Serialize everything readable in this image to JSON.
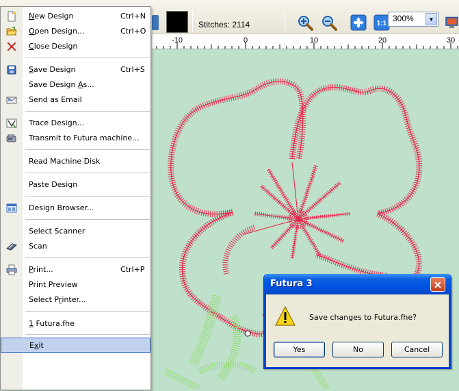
{
  "toolbar": {
    "stitches": "Stitches: 2114",
    "zoom_value": "300%",
    "icons": [
      "zoom-in-icon",
      "zoom-out-icon",
      "fit-to-window-icon",
      "actual-size-icon",
      "monitor-icon"
    ],
    "actual_size_label": "1:1"
  },
  "ruler": {
    "labels": [
      "-10",
      "0",
      "10",
      "20",
      "30"
    ]
  },
  "file_menu": {
    "items": [
      {
        "label": "New Design",
        "shortcut": "Ctrl+N",
        "icon": "new-design-icon"
      },
      {
        "label": "Open Design...",
        "shortcut": "Ctrl+O",
        "icon": "open-folder-icon"
      },
      {
        "label": "Close Design",
        "shortcut": "",
        "icon": "close-x-icon"
      },
      {
        "label": "Save Design",
        "shortcut": "Ctrl+S",
        "icon": "save-disk-icon"
      },
      {
        "label": "Save Design As...",
        "shortcut": "",
        "icon": ""
      },
      {
        "label": "Send as Email",
        "shortcut": "",
        "icon": "email-icon"
      },
      {
        "label": "Trace Design...",
        "shortcut": "",
        "icon": "trace-icon"
      },
      {
        "label": "Transmit to Futura machine...",
        "shortcut": "",
        "icon": "transmit-icon"
      },
      {
        "label": "Read Machine Disk",
        "shortcut": "",
        "icon": ""
      },
      {
        "label": "Paste Design",
        "shortcut": "",
        "icon": ""
      },
      {
        "label": "Design Browser...",
        "shortcut": "",
        "icon": "design-browser-icon"
      },
      {
        "label": "Select Scanner",
        "shortcut": "",
        "icon": ""
      },
      {
        "label": "Scan",
        "shortcut": "",
        "icon": "scan-icon"
      },
      {
        "label": "Print...",
        "shortcut": "Ctrl+P",
        "icon": "printer-icon"
      },
      {
        "label": "Print Preview",
        "shortcut": "",
        "icon": ""
      },
      {
        "label": "Select Printer...",
        "shortcut": "",
        "icon": ""
      },
      {
        "label": "1 Futura.fhe",
        "shortcut": "",
        "icon": ""
      },
      {
        "label": "Exit",
        "shortcut": "",
        "icon": ""
      }
    ]
  },
  "dialog": {
    "title": "Futura 3",
    "message": "Save changes to Futura.fhe?",
    "buttons": [
      "Yes",
      "No",
      "Cancel"
    ]
  },
  "colors": {
    "canvas": "#bfe0ca",
    "stitch_red": "#e8254a",
    "stitch_green": "#8fdc6a",
    "menu_highlight": "#c1d2ee",
    "dialog_title": "#0054e3"
  }
}
